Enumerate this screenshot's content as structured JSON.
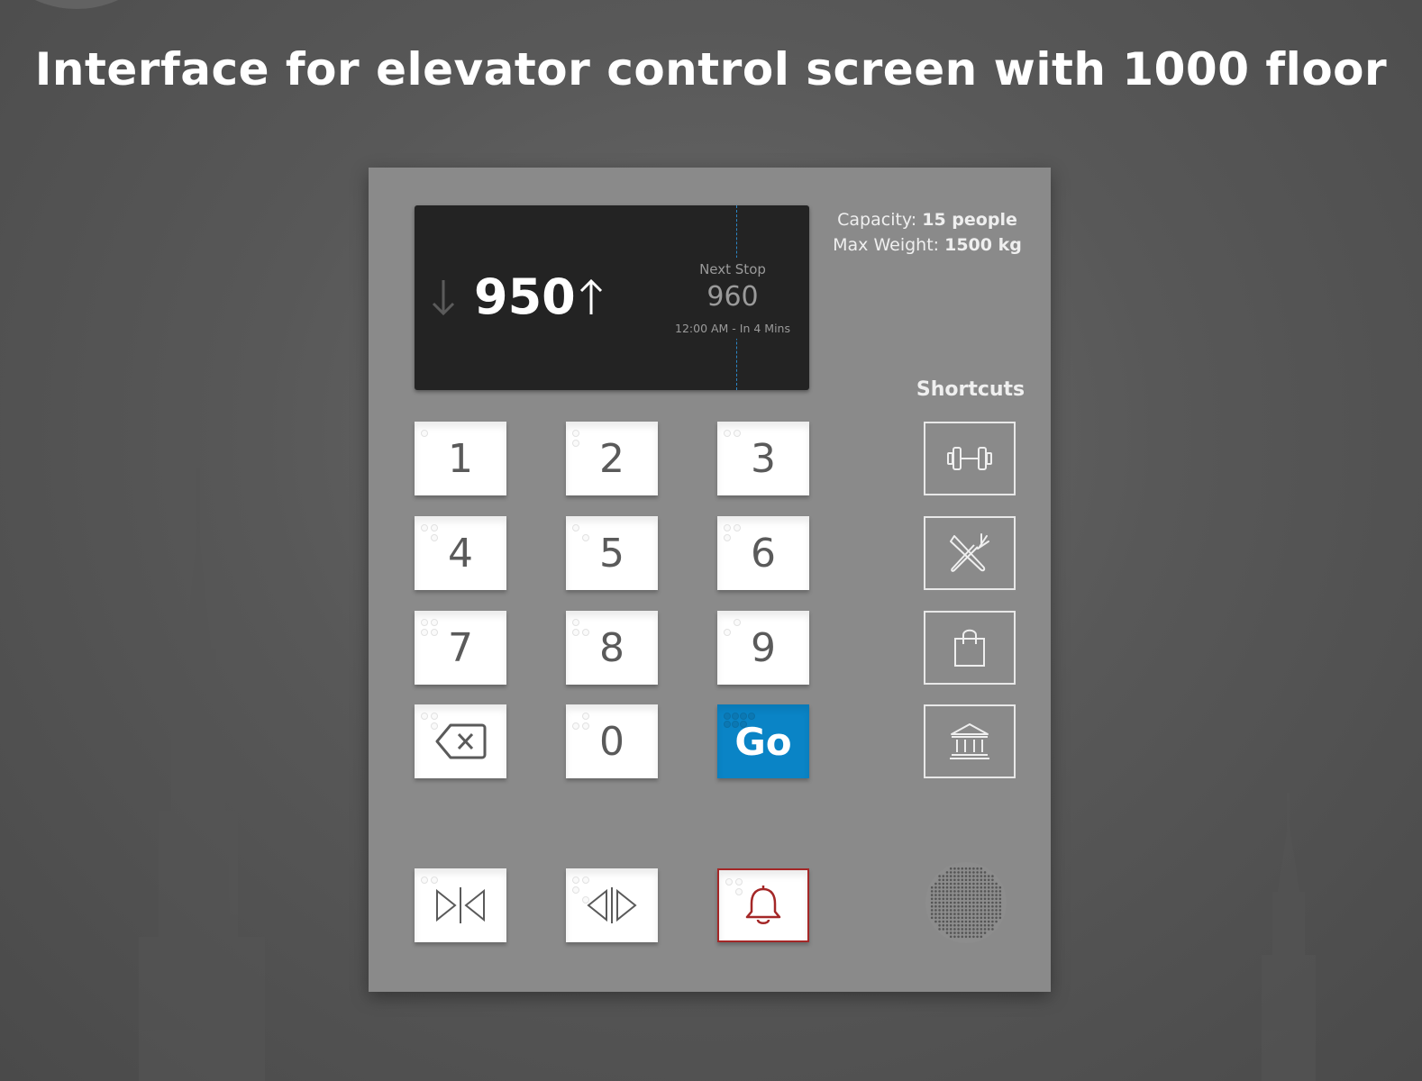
{
  "headline": "Interface for elevator control screen with 1000 floor",
  "display": {
    "current_floor": "950",
    "next_stop_label": "Next Stop",
    "next_stop_floor": "960",
    "next_stop_time": "12:00 AM - In 4 Mins"
  },
  "specs": {
    "capacity_label": "Capacity:",
    "capacity_value": "15 people",
    "max_weight_label": "Max Weight:",
    "max_weight_value": "1500 kg"
  },
  "keypad": {
    "keys": [
      "1",
      "2",
      "3",
      "4",
      "5",
      "6",
      "7",
      "8",
      "9",
      "0"
    ],
    "go_label": "Go",
    "backspace_icon": "backspace-icon"
  },
  "controls": {
    "close_door_icon": "door-close-icon",
    "open_door_icon": "door-open-icon",
    "alarm_icon": "alarm-bell-icon"
  },
  "shortcuts": {
    "title": "Shortcuts",
    "items": [
      "gym-icon",
      "restaurant-icon",
      "shopping-bag-icon",
      "bank-icon"
    ]
  },
  "colors": {
    "go_button": "#0a84c6",
    "alarm": "#a42727",
    "divider": "#2b86c5"
  }
}
